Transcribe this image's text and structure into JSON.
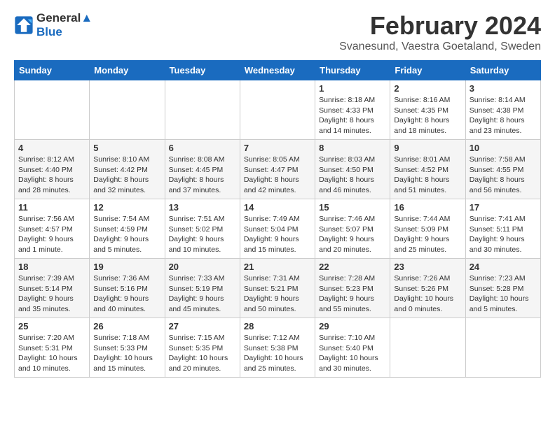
{
  "logo": {
    "line1": "General",
    "line2": "Blue"
  },
  "title": "February 2024",
  "location": "Svanesund, Vaestra Goetaland, Sweden",
  "days_of_week": [
    "Sunday",
    "Monday",
    "Tuesday",
    "Wednesday",
    "Thursday",
    "Friday",
    "Saturday"
  ],
  "weeks": [
    [
      {
        "day": "",
        "info": ""
      },
      {
        "day": "",
        "info": ""
      },
      {
        "day": "",
        "info": ""
      },
      {
        "day": "",
        "info": ""
      },
      {
        "day": "1",
        "info": "Sunrise: 8:18 AM\nSunset: 4:33 PM\nDaylight: 8 hours\nand 14 minutes."
      },
      {
        "day": "2",
        "info": "Sunrise: 8:16 AM\nSunset: 4:35 PM\nDaylight: 8 hours\nand 18 minutes."
      },
      {
        "day": "3",
        "info": "Sunrise: 8:14 AM\nSunset: 4:38 PM\nDaylight: 8 hours\nand 23 minutes."
      }
    ],
    [
      {
        "day": "4",
        "info": "Sunrise: 8:12 AM\nSunset: 4:40 PM\nDaylight: 8 hours\nand 28 minutes."
      },
      {
        "day": "5",
        "info": "Sunrise: 8:10 AM\nSunset: 4:42 PM\nDaylight: 8 hours\nand 32 minutes."
      },
      {
        "day": "6",
        "info": "Sunrise: 8:08 AM\nSunset: 4:45 PM\nDaylight: 8 hours\nand 37 minutes."
      },
      {
        "day": "7",
        "info": "Sunrise: 8:05 AM\nSunset: 4:47 PM\nDaylight: 8 hours\nand 42 minutes."
      },
      {
        "day": "8",
        "info": "Sunrise: 8:03 AM\nSunset: 4:50 PM\nDaylight: 8 hours\nand 46 minutes."
      },
      {
        "day": "9",
        "info": "Sunrise: 8:01 AM\nSunset: 4:52 PM\nDaylight: 8 hours\nand 51 minutes."
      },
      {
        "day": "10",
        "info": "Sunrise: 7:58 AM\nSunset: 4:55 PM\nDaylight: 8 hours\nand 56 minutes."
      }
    ],
    [
      {
        "day": "11",
        "info": "Sunrise: 7:56 AM\nSunset: 4:57 PM\nDaylight: 9 hours\nand 1 minute."
      },
      {
        "day": "12",
        "info": "Sunrise: 7:54 AM\nSunset: 4:59 PM\nDaylight: 9 hours\nand 5 minutes."
      },
      {
        "day": "13",
        "info": "Sunrise: 7:51 AM\nSunset: 5:02 PM\nDaylight: 9 hours\nand 10 minutes."
      },
      {
        "day": "14",
        "info": "Sunrise: 7:49 AM\nSunset: 5:04 PM\nDaylight: 9 hours\nand 15 minutes."
      },
      {
        "day": "15",
        "info": "Sunrise: 7:46 AM\nSunset: 5:07 PM\nDaylight: 9 hours\nand 20 minutes."
      },
      {
        "day": "16",
        "info": "Sunrise: 7:44 AM\nSunset: 5:09 PM\nDaylight: 9 hours\nand 25 minutes."
      },
      {
        "day": "17",
        "info": "Sunrise: 7:41 AM\nSunset: 5:11 PM\nDaylight: 9 hours\nand 30 minutes."
      }
    ],
    [
      {
        "day": "18",
        "info": "Sunrise: 7:39 AM\nSunset: 5:14 PM\nDaylight: 9 hours\nand 35 minutes."
      },
      {
        "day": "19",
        "info": "Sunrise: 7:36 AM\nSunset: 5:16 PM\nDaylight: 9 hours\nand 40 minutes."
      },
      {
        "day": "20",
        "info": "Sunrise: 7:33 AM\nSunset: 5:19 PM\nDaylight: 9 hours\nand 45 minutes."
      },
      {
        "day": "21",
        "info": "Sunrise: 7:31 AM\nSunset: 5:21 PM\nDaylight: 9 hours\nand 50 minutes."
      },
      {
        "day": "22",
        "info": "Sunrise: 7:28 AM\nSunset: 5:23 PM\nDaylight: 9 hours\nand 55 minutes."
      },
      {
        "day": "23",
        "info": "Sunrise: 7:26 AM\nSunset: 5:26 PM\nDaylight: 10 hours\nand 0 minutes."
      },
      {
        "day": "24",
        "info": "Sunrise: 7:23 AM\nSunset: 5:28 PM\nDaylight: 10 hours\nand 5 minutes."
      }
    ],
    [
      {
        "day": "25",
        "info": "Sunrise: 7:20 AM\nSunset: 5:31 PM\nDaylight: 10 hours\nand 10 minutes."
      },
      {
        "day": "26",
        "info": "Sunrise: 7:18 AM\nSunset: 5:33 PM\nDaylight: 10 hours\nand 15 minutes."
      },
      {
        "day": "27",
        "info": "Sunrise: 7:15 AM\nSunset: 5:35 PM\nDaylight: 10 hours\nand 20 minutes."
      },
      {
        "day": "28",
        "info": "Sunrise: 7:12 AM\nSunset: 5:38 PM\nDaylight: 10 hours\nand 25 minutes."
      },
      {
        "day": "29",
        "info": "Sunrise: 7:10 AM\nSunset: 5:40 PM\nDaylight: 10 hours\nand 30 minutes."
      },
      {
        "day": "",
        "info": ""
      },
      {
        "day": "",
        "info": ""
      }
    ]
  ]
}
